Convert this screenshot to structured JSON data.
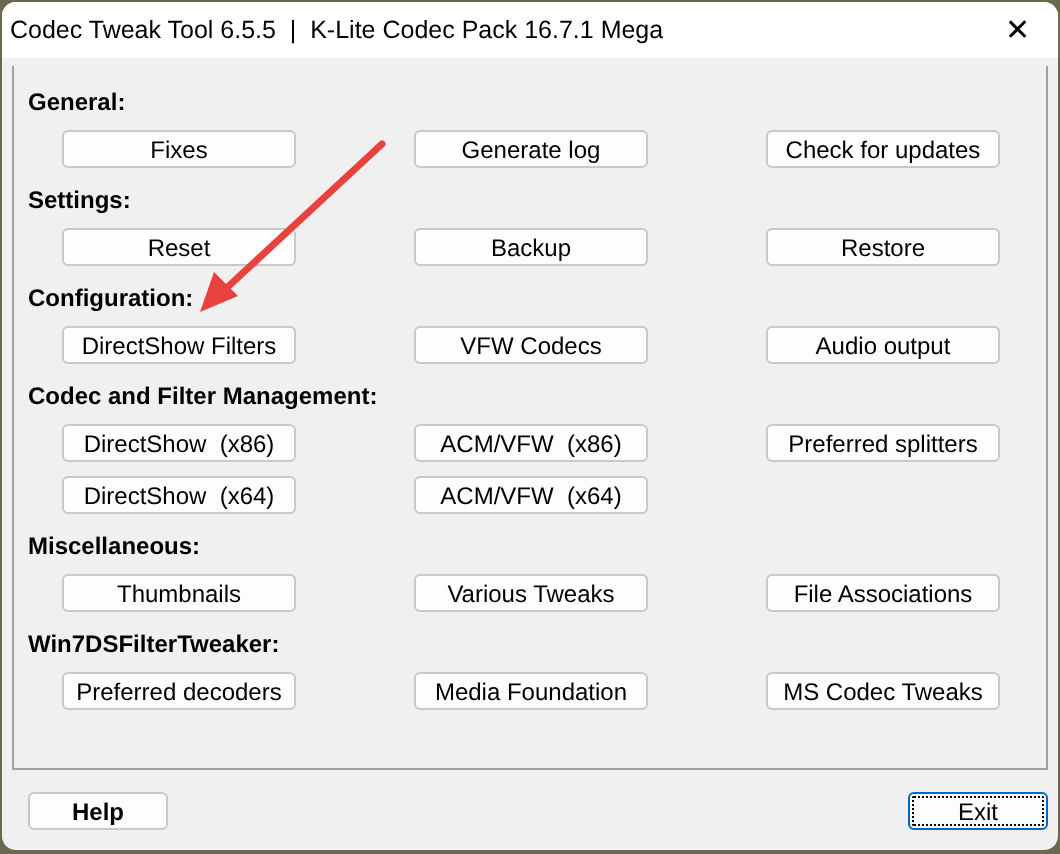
{
  "window": {
    "title": "Codec Tweak Tool 6.5.5  |  K-Lite Codec Pack 16.7.1 Mega",
    "close": "✕"
  },
  "sections": [
    {
      "heading": "General:",
      "rows": [
        [
          "Fixes",
          "Generate log",
          "Check for updates"
        ]
      ]
    },
    {
      "heading": "Settings:",
      "rows": [
        [
          "Reset",
          "Backup",
          "Restore"
        ]
      ]
    },
    {
      "heading": "Configuration:",
      "rows": [
        [
          "DirectShow Filters",
          "VFW Codecs",
          "Audio output"
        ]
      ]
    },
    {
      "heading": "Codec and Filter Management:",
      "rows": [
        [
          "DirectShow  (x86)",
          "ACM/VFW  (x86)",
          "Preferred splitters"
        ],
        [
          "DirectShow  (x64)",
          "ACM/VFW  (x64)"
        ]
      ]
    },
    {
      "heading": "Miscellaneous:",
      "rows": [
        [
          "Thumbnails",
          "Various Tweaks",
          "File Associations"
        ]
      ]
    },
    {
      "heading": "Win7DSFilterTweaker:",
      "rows": [
        [
          "Preferred decoders",
          "Media Foundation",
          "MS Codec Tweaks"
        ]
      ]
    }
  ],
  "footer": [
    {
      "label": "Help",
      "bold": true,
      "default": false
    },
    {
      "label": "Exit",
      "bold": false,
      "default": true
    }
  ]
}
